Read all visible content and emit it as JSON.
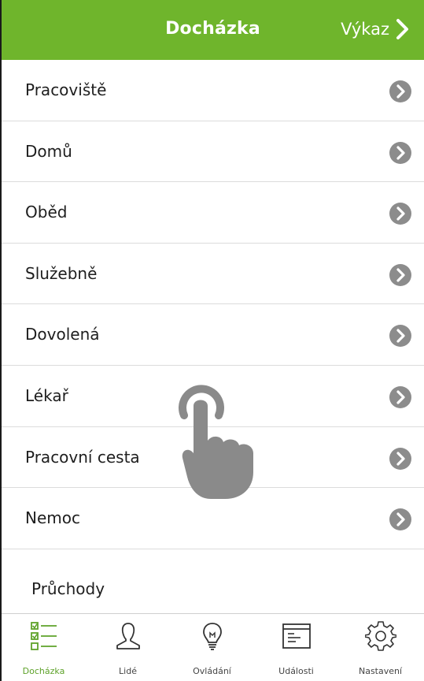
{
  "header": {
    "title": "Docházka",
    "right_label": "Výkaz"
  },
  "list": {
    "items": [
      {
        "label": "Pracoviště"
      },
      {
        "label": "Domů"
      },
      {
        "label": "Oběd"
      },
      {
        "label": "Služebně"
      },
      {
        "label": "Dovolená"
      },
      {
        "label": "Lékař"
      },
      {
        "label": "Pracovní cesta"
      },
      {
        "label": "Nemoc"
      }
    ],
    "section_label": "Průchody"
  },
  "tabbar": {
    "tabs": [
      {
        "label": "Docházka",
        "icon": "checklist-icon",
        "active": true
      },
      {
        "label": "Lidé",
        "icon": "person-icon",
        "active": false
      },
      {
        "label": "Ovládání",
        "icon": "lightbulb-icon",
        "active": false
      },
      {
        "label": "Události",
        "icon": "events-window-icon",
        "active": false
      },
      {
        "label": "Nastavení",
        "icon": "gear-icon",
        "active": false
      }
    ]
  },
  "colors": {
    "accent": "#6fb52c",
    "arrow": "#8c8c8c",
    "divider": "#dcdcdc",
    "active_tab": "#5ea22a"
  }
}
